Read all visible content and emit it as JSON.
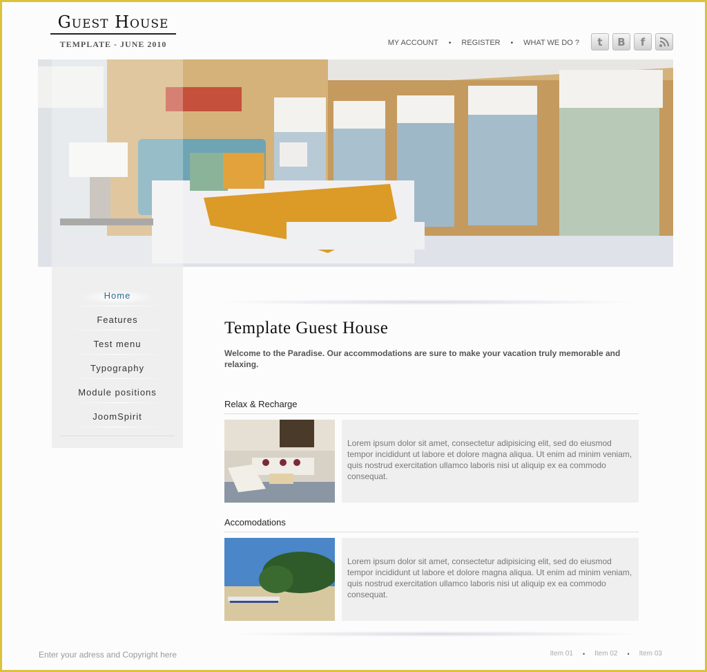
{
  "logo": {
    "title": "Guest House",
    "subtitle": "Template - June 2010"
  },
  "topnav": {
    "items": [
      "My Account",
      "Register",
      "What we do ?"
    ],
    "separator": "•"
  },
  "social": [
    {
      "name": "twitter",
      "glyph": "t"
    },
    {
      "name": "blogger",
      "glyph": "B"
    },
    {
      "name": "facebook",
      "glyph": "f"
    },
    {
      "name": "rss",
      "glyph": "◝"
    }
  ],
  "hero": {
    "description": "Bedroom with bed, lamp and large windows overlooking a marina"
  },
  "sidebar": {
    "items": [
      {
        "label": "Home",
        "active": true
      },
      {
        "label": "Features"
      },
      {
        "label": "Test menu"
      },
      {
        "label": "Typography"
      },
      {
        "label": "Module positions"
      },
      {
        "label": "JoomSpirit"
      }
    ]
  },
  "main": {
    "title": "Template Guest House",
    "intro": "Welcome to the Paradise. Our accommodations are sure to make your vacation truly memorable and relaxing.",
    "sections": [
      {
        "title": "Relax & Recharge",
        "image": "Patio lounge with chairs",
        "text": "Lorem ipsum dolor sit amet, consectetur adipisicing elit, sed do eiusmod tempor incididunt ut labore et dolore magna aliqua. Ut enim ad minim veniam, quis nostrud exercitation ullamco laboris nisi ut aliquip ex ea commodo consequat."
      },
      {
        "title": "Accomodations",
        "image": "Beach with boats and trees",
        "text": "Lorem ipsum dolor sit amet, consectetur adipisicing elit, sed do eiusmod tempor incididunt ut labore et dolore magna aliqua. Ut enim ad minim veniam, quis nostrud exercitation ullamco laboris nisi ut aliquip ex ea commodo consequat."
      }
    ]
  },
  "footer": {
    "copyright": "Enter your adress and Copyright here",
    "links": [
      "Item 01",
      "Item 02",
      "Item 03"
    ],
    "separator": "•"
  },
  "colors": {
    "border": "#dcc23a",
    "active_menu": "#2a6a8e",
    "panel_bg": "#efeff0"
  }
}
